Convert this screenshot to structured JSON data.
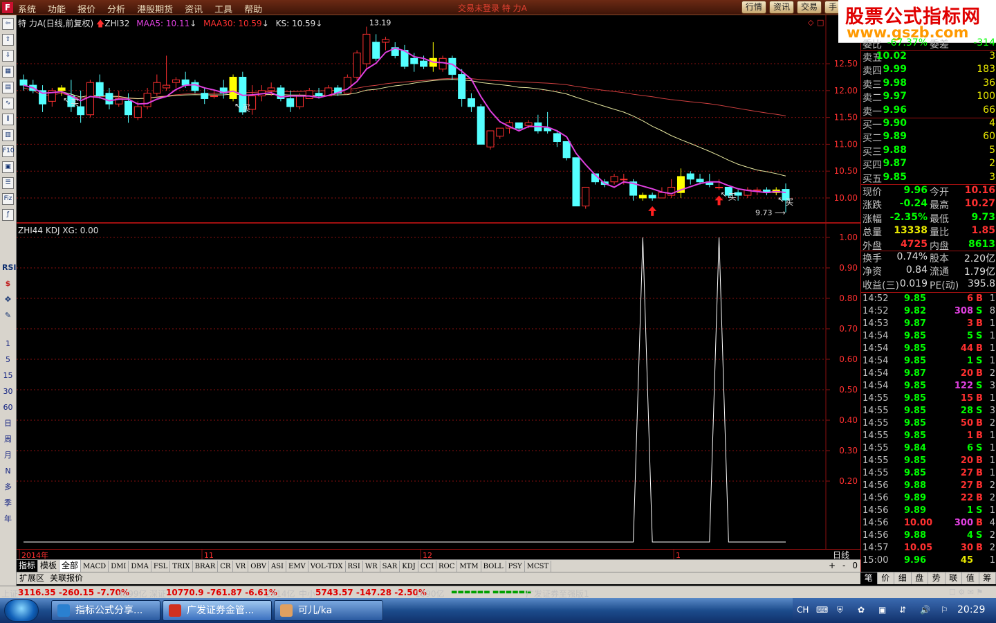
{
  "menu": {
    "logo": "F",
    "items": [
      "系统",
      "功能",
      "报价",
      "分析",
      "港股期货",
      "资讯",
      "工具",
      "帮助"
    ],
    "ticker": "交易未登录   特   力A",
    "right_buttons": [
      "行情",
      "资讯",
      "交易",
      "手"
    ]
  },
  "watermark": {
    "line1": "股票公式指标网",
    "line2": "www.gszb.com"
  },
  "toolbar": {
    "icons": [
      "back-icon",
      "up-icon",
      "down-icon",
      "quote-icon",
      "table-icon",
      "line-chart-icon",
      "kline-icon",
      "volume-icon",
      "f10-icon",
      "report-icon",
      "notes-icon",
      "fiz-icon",
      "f-icon"
    ],
    "labels2": [
      "RSI",
      "$",
      "✥",
      "✎"
    ],
    "periods": [
      "1",
      "5",
      "15",
      "30",
      "60",
      "日",
      "周",
      "月",
      "N",
      "多",
      "季",
      "年"
    ]
  },
  "pane1": {
    "name": "特 力A(日线,前复权)",
    "indicator": "ZHI32",
    "ma5_label": "MAA5: 10.11",
    "ma30_label": "MAA30: 10.59",
    "ks_label": "KS: 10.59",
    "y_ticks": [
      "12.50",
      "12.00",
      "11.50",
      "11.00",
      "10.50",
      "10.00"
    ],
    "hi_label": "13.19",
    "lo_label": "9.73",
    "buy_labels": [
      "买",
      "买",
      "买",
      "买"
    ]
  },
  "pane2": {
    "title": "ZHI44 KDJ XG: 0.00",
    "y_ticks": [
      "1.00",
      "0.90",
      "0.80",
      "0.70",
      "0.60",
      "0.50",
      "0.40",
      "0.30",
      "0.20"
    ]
  },
  "dates": [
    "2014年",
    "11",
    "12",
    "1"
  ],
  "period_label": "日线",
  "tabs": [
    "指标",
    "模板",
    "全部",
    "MACD",
    "DMI",
    "DMA",
    "FSL",
    "TRIX",
    "BRAR",
    "CR",
    "VR",
    "OBV",
    "ASI",
    "EMV",
    "VOL-TDX",
    "RSI",
    "WR",
    "SAR",
    "KDJ",
    "CCI",
    "ROC",
    "MTM",
    "BOLL",
    "PSY",
    "MCST"
  ],
  "tab_ctrl": [
    "+",
    "-",
    "0"
  ],
  "ext_tabs": [
    "扩展区",
    "关联报价"
  ],
  "rpanel": {
    "weibi": {
      "label": "委比",
      "value": "-67.37%",
      "label2": "委差",
      "value2": "-314"
    },
    "sell": [
      {
        "label": "卖五",
        "price": "10.02",
        "vol": "3"
      },
      {
        "label": "卖四",
        "price": "9.99",
        "vol": "183"
      },
      {
        "label": "卖三",
        "price": "9.98",
        "vol": "36"
      },
      {
        "label": "卖二",
        "price": "9.97",
        "vol": "100"
      },
      {
        "label": "卖一",
        "price": "9.96",
        "vol": "66"
      }
    ],
    "buy": [
      {
        "label": "买一",
        "price": "9.90",
        "vol": "4"
      },
      {
        "label": "买二",
        "price": "9.89",
        "vol": "60"
      },
      {
        "label": "买三",
        "price": "9.88",
        "vol": "5"
      },
      {
        "label": "买四",
        "price": "9.87",
        "vol": "2"
      },
      {
        "label": "买五",
        "price": "9.85",
        "vol": "3"
      }
    ],
    "quote": [
      {
        "l1": "现价",
        "v1": "9.96",
        "c1": "#00ff00",
        "l2": "今开",
        "v2": "10.16",
        "c2": "#ff3030"
      },
      {
        "l1": "涨跌",
        "v1": "-0.24",
        "c1": "#00ff00",
        "l2": "最高",
        "v2": "10.27",
        "c2": "#ff3030"
      },
      {
        "l1": "涨幅",
        "v1": "-2.35%",
        "c1": "#00ff00",
        "l2": "最低",
        "v2": "9.73",
        "c2": "#00ff00"
      },
      {
        "l1": "总量",
        "v1": "13338",
        "c1": "#e8e800",
        "l2": "量比",
        "v2": "1.85",
        "c2": "#ff3030"
      },
      {
        "l1": "外盘",
        "v1": "4725",
        "c1": "#ff3030",
        "l2": "内盘",
        "v2": "8613",
        "c2": "#00ff00"
      }
    ],
    "quote2": [
      {
        "l1": "换手",
        "v1": "0.74%",
        "l2": "股本",
        "v2": "2.20亿"
      },
      {
        "l1": "净资",
        "v1": "0.84",
        "l2": "流通",
        "v2": "1.79亿"
      },
      {
        "l1": "收益(三)",
        "v1": "0.019",
        "l2": "PE(动)",
        "v2": "395.8"
      }
    ],
    "ticks": [
      {
        "t": "14:52",
        "p": "9.85",
        "v": "6",
        "s": "B",
        "n": "1"
      },
      {
        "t": "14:52",
        "p": "9.82",
        "v": "308",
        "s": "S",
        "n": "8"
      },
      {
        "t": "14:53",
        "p": "9.87",
        "v": "3",
        "s": "B",
        "n": "1"
      },
      {
        "t": "14:54",
        "p": "9.85",
        "v": "5",
        "s": "S",
        "n": "1"
      },
      {
        "t": "14:54",
        "p": "9.85",
        "v": "44",
        "s": "B",
        "n": "1"
      },
      {
        "t": "14:54",
        "p": "9.85",
        "v": "1",
        "s": "S",
        "n": "1"
      },
      {
        "t": "14:54",
        "p": "9.87",
        "v": "20",
        "s": "B",
        "n": "2"
      },
      {
        "t": "14:54",
        "p": "9.85",
        "v": "122",
        "s": "S",
        "n": "3"
      },
      {
        "t": "14:55",
        "p": "9.85",
        "v": "15",
        "s": "B",
        "n": "1"
      },
      {
        "t": "14:55",
        "p": "9.85",
        "v": "28",
        "s": "S",
        "n": "3"
      },
      {
        "t": "14:55",
        "p": "9.85",
        "v": "50",
        "s": "B",
        "n": "2"
      },
      {
        "t": "14:55",
        "p": "9.85",
        "v": "1",
        "s": "B",
        "n": "1"
      },
      {
        "t": "14:55",
        "p": "9.84",
        "v": "6",
        "s": "S",
        "n": "1"
      },
      {
        "t": "14:55",
        "p": "9.85",
        "v": "20",
        "s": "B",
        "n": "1"
      },
      {
        "t": "14:55",
        "p": "9.85",
        "v": "27",
        "s": "B",
        "n": "1"
      },
      {
        "t": "14:56",
        "p": "9.88",
        "v": "27",
        "s": "B",
        "n": "2"
      },
      {
        "t": "14:56",
        "p": "9.89",
        "v": "22",
        "s": "B",
        "n": "2"
      },
      {
        "t": "14:56",
        "p": "9.89",
        "v": "1",
        "s": "S",
        "n": "1"
      },
      {
        "t": "14:56",
        "p": "10.00",
        "v": "300",
        "s": "B",
        "n": "4"
      },
      {
        "t": "14:56",
        "p": "9.88",
        "v": "4",
        "s": "S",
        "n": "2"
      },
      {
        "t": "14:57",
        "p": "10.05",
        "v": "30",
        "s": "B",
        "n": "2"
      },
      {
        "t": "15:00",
        "p": "9.96",
        "v": "45",
        "s": "",
        "n": "1"
      }
    ],
    "tabs": [
      "笔",
      "价",
      "细",
      "盘",
      "势",
      "联",
      "值",
      "筹"
    ]
  },
  "status": {
    "sh_label": "上证",
    "sh_value": "3116.35 -260.15 -7.70%",
    "sh_amount": "4099亿",
    "sz_label": "深证",
    "sz_value": "10770.9 -761.87 -6.61%",
    "sz_amount": "2914亿",
    "zx_label": "中小",
    "zx_value": "5743.57 -147.28 -2.50%",
    "zx_amount": "1090亿",
    "broker": "广发证券至强版1"
  },
  "taskbar": {
    "tasks": [
      "指标公式分享...",
      "广发证券金管...",
      "可儿/ka"
    ],
    "tray_lang": "CH",
    "clock": "20:29"
  },
  "colors": {
    "up": "#ff3030",
    "down": "#00ff00",
    "candle_down": "#54ffff",
    "ma5": "#e040e0",
    "ma30": "#e8e8a0",
    "ks": "#d04040",
    "grid": "#8a1010"
  },
  "chart_data": {
    "type": "candlestick",
    "y_range": [
      9.6,
      13.3
    ],
    "ohlc": [
      [
        12.2,
        12.3,
        12.0,
        12.1
      ],
      [
        12.1,
        12.2,
        11.95,
        12.0
      ],
      [
        12.0,
        12.1,
        11.6,
        11.75
      ],
      [
        11.8,
        12.05,
        11.7,
        12.0
      ],
      [
        12.0,
        12.1,
        11.9,
        12.05
      ],
      [
        11.9,
        12.2,
        11.6,
        11.7
      ],
      [
        11.7,
        12.0,
        11.4,
        11.55
      ],
      [
        11.55,
        12.2,
        11.5,
        12.15
      ],
      [
        12.15,
        12.3,
        11.85,
        11.9
      ],
      [
        11.95,
        12.05,
        11.65,
        11.75
      ],
      [
        11.75,
        12.0,
        11.7,
        11.85
      ],
      [
        11.8,
        11.95,
        11.4,
        11.55
      ],
      [
        11.5,
        11.8,
        11.45,
        11.7
      ],
      [
        11.7,
        12.05,
        11.65,
        11.95
      ],
      [
        11.95,
        12.3,
        11.9,
        12.15
      ],
      [
        12.05,
        12.65,
        12.0,
        12.1
      ],
      [
        12.15,
        12.25,
        12.05,
        12.2
      ],
      [
        12.2,
        12.35,
        12.05,
        12.1
      ],
      [
        12.15,
        12.2,
        11.95,
        12.0
      ],
      [
        11.95,
        12.05,
        11.75,
        11.85
      ],
      [
        11.9,
        12.0,
        11.85,
        11.9
      ],
      [
        12.05,
        12.2,
        11.85,
        11.95
      ],
      [
        11.85,
        12.3,
        11.8,
        12.25
      ],
      [
        12.25,
        12.35,
        11.55,
        11.6
      ],
      [
        11.65,
        12.1,
        11.55,
        11.9
      ],
      [
        11.9,
        12.1,
        11.8,
        12.0
      ],
      [
        12.0,
        12.15,
        11.9,
        12.05
      ],
      [
        12.05,
        12.1,
        11.8,
        11.85
      ],
      [
        11.85,
        12.0,
        11.6,
        11.7
      ],
      [
        11.7,
        11.95,
        11.65,
        11.9
      ],
      [
        11.85,
        12.05,
        11.85,
        12.0
      ],
      [
        11.95,
        12.05,
        11.85,
        11.9
      ],
      [
        11.9,
        12.1,
        11.9,
        12.05
      ],
      [
        12.05,
        12.1,
        11.9,
        11.95
      ],
      [
        11.95,
        12.3,
        11.95,
        12.25
      ],
      [
        12.25,
        12.75,
        12.2,
        12.7
      ],
      [
        12.5,
        13.19,
        12.4,
        13.05
      ],
      [
        12.9,
        13.05,
        12.55,
        12.6
      ],
      [
        12.9,
        13.0,
        12.75,
        12.95
      ],
      [
        12.8,
        12.9,
        12.6,
        12.65
      ],
      [
        12.75,
        12.85,
        12.4,
        12.45
      ],
      [
        12.6,
        12.7,
        12.35,
        12.5
      ],
      [
        12.55,
        12.65,
        12.4,
        12.45
      ],
      [
        12.45,
        12.9,
        12.35,
        12.6
      ],
      [
        12.4,
        12.65,
        12.35,
        12.6
      ],
      [
        12.6,
        12.65,
        12.2,
        12.3
      ],
      [
        12.3,
        12.4,
        11.7,
        11.85
      ],
      [
        11.85,
        11.95,
        11.6,
        11.7
      ],
      [
        11.7,
        11.75,
        11.0,
        11.0
      ],
      [
        10.95,
        11.25,
        10.9,
        11.25
      ],
      [
        11.15,
        11.3,
        11.1,
        11.3
      ],
      [
        11.3,
        11.45,
        11.2,
        11.4
      ],
      [
        11.4,
        11.4,
        11.25,
        11.3
      ],
      [
        11.35,
        11.45,
        11.3,
        11.4
      ],
      [
        11.4,
        11.55,
        11.2,
        11.25
      ],
      [
        11.3,
        11.6,
        11.2,
        11.25
      ],
      [
        11.2,
        11.25,
        10.95,
        11.05
      ],
      [
        11.05,
        11.05,
        10.7,
        10.75
      ],
      [
        10.75,
        10.75,
        9.85,
        9.85
      ],
      [
        9.85,
        10.2,
        9.8,
        10.2
      ],
      [
        10.45,
        10.45,
        10.25,
        10.3
      ],
      [
        10.3,
        10.35,
        10.2,
        10.25
      ],
      [
        10.3,
        10.45,
        10.25,
        10.4
      ],
      [
        10.35,
        10.45,
        10.25,
        10.35
      ],
      [
        10.3,
        10.35,
        9.95,
        10.05
      ],
      [
        10.0,
        10.1,
        9.95,
        10.05
      ],
      [
        10.05,
        10.1,
        9.95,
        10.0
      ],
      [
        10.0,
        10.2,
        10.0,
        10.1
      ],
      [
        10.05,
        10.35,
        10.0,
        10.2
      ],
      [
        10.1,
        10.55,
        10.0,
        10.4
      ],
      [
        10.45,
        10.5,
        10.25,
        10.35
      ],
      [
        10.35,
        10.45,
        10.25,
        10.3
      ],
      [
        10.3,
        10.45,
        10.2,
        10.25
      ],
      [
        10.2,
        10.35,
        10.15,
        10.2
      ],
      [
        10.2,
        10.2,
        10.0,
        10.05
      ],
      [
        10.1,
        10.15,
        9.95,
        10.05
      ],
      [
        10.05,
        10.2,
        10.0,
        10.15
      ],
      [
        10.15,
        10.2,
        10.05,
        10.15
      ],
      [
        10.15,
        10.2,
        10.05,
        10.1
      ],
      [
        10.1,
        10.2,
        10.05,
        10.15
      ],
      [
        10.16,
        10.27,
        9.73,
        9.96
      ]
    ],
    "signal_days": [
      4,
      22,
      43,
      65,
      69,
      79
    ],
    "up_arrow_days": [
      66,
      73
    ],
    "kdj_xg": {
      "spike_days": [
        65,
        73
      ],
      "value": 1.0,
      "base": 0.0,
      "y_range": [
        0,
        1.0
      ]
    }
  }
}
